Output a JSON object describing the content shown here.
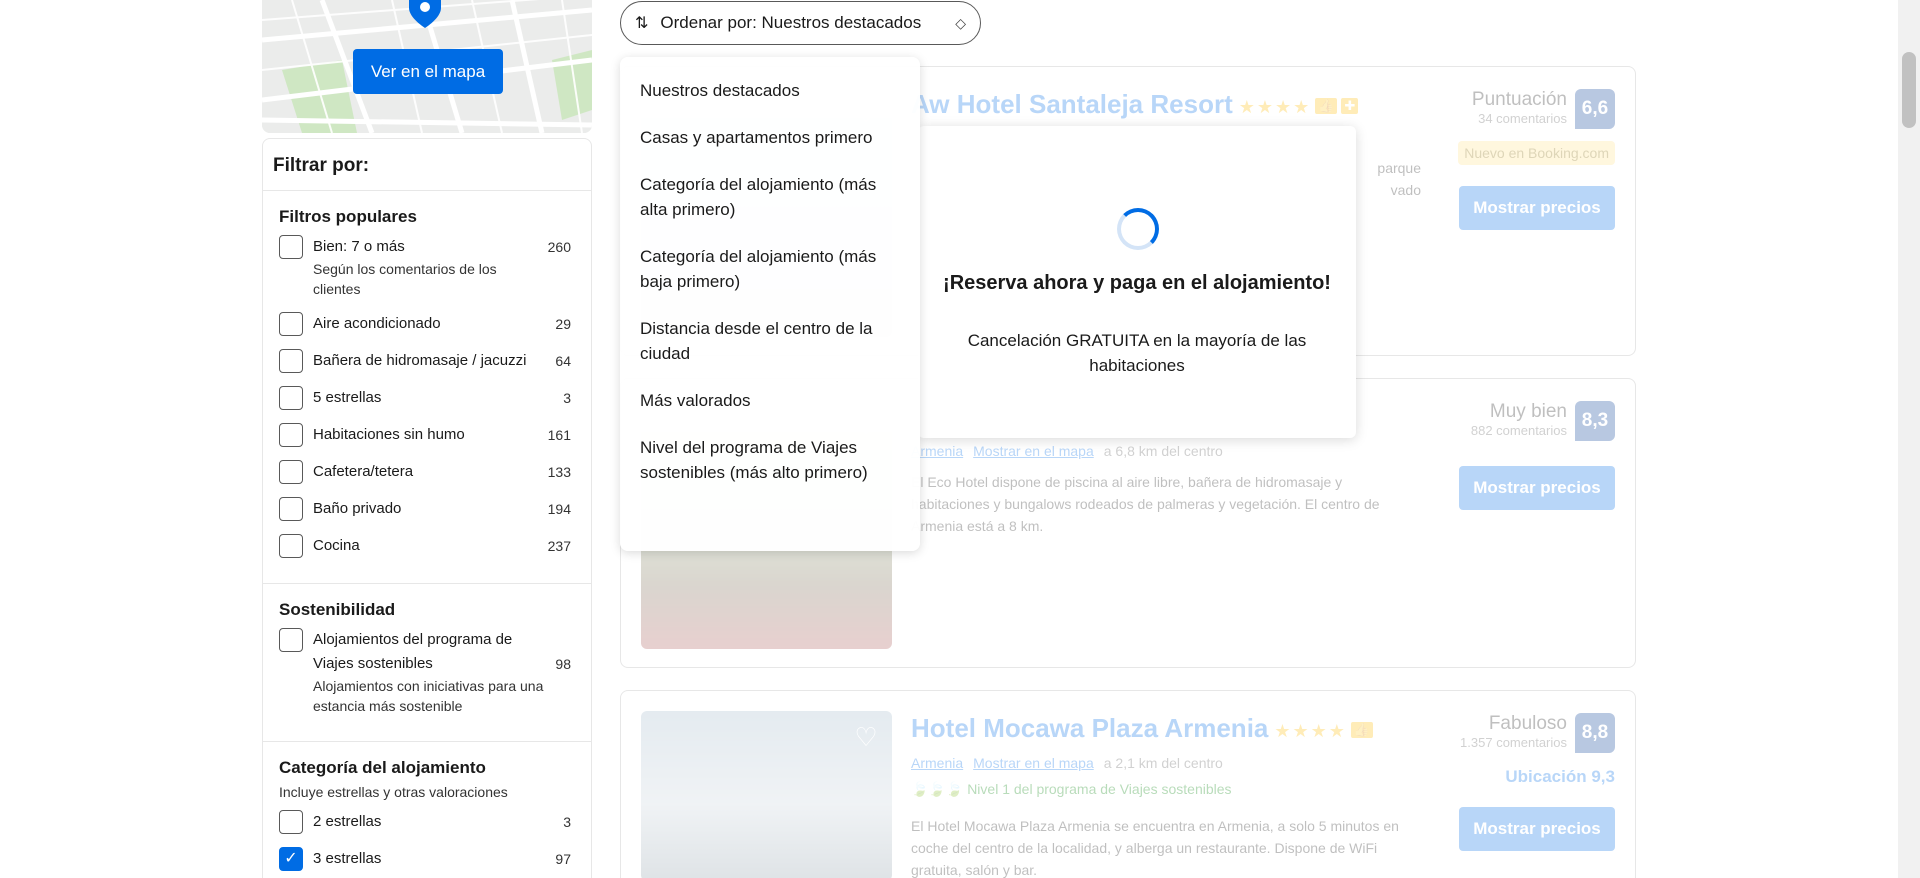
{
  "map": {
    "button_label": "Ver en el mapa"
  },
  "filters": {
    "title": "Filtrar por:",
    "popular": {
      "title": "Filtros populares",
      "items": [
        {
          "label": "Bien: 7 o más",
          "count": "260",
          "note": "Según los comentarios de los clientes"
        },
        {
          "label": "Aire acondicionado",
          "count": "29"
        },
        {
          "label": "Bañera de hidromasaje / jacuzzi",
          "count": "64"
        },
        {
          "label": "5 estrellas",
          "count": "3"
        },
        {
          "label": "Habitaciones sin humo",
          "count": "161"
        },
        {
          "label": "Cafetera/tetera",
          "count": "133"
        },
        {
          "label": "Baño privado",
          "count": "194"
        },
        {
          "label": "Cocina",
          "count": "237"
        }
      ]
    },
    "sustainability": {
      "title": "Sostenibilidad",
      "items": [
        {
          "label": "Alojamientos del programa de Viajes sostenibles",
          "count": "98",
          "note": "Alojamientos con iniciativas para una estancia más sostenible"
        }
      ]
    },
    "category": {
      "title": "Categoría del alojamiento",
      "subtitle": "Incluye estrellas y otras valoraciones",
      "items": [
        {
          "label": "2 estrellas",
          "count": "3",
          "checked": false
        },
        {
          "label": "3 estrellas",
          "count": "97",
          "checked": true
        }
      ]
    }
  },
  "sort": {
    "button_label": "Ordenar por: Nuestros destacados",
    "options": [
      "Nuestros destacados",
      "Casas y apartamentos primero",
      "Categoría del alojamiento (más alta primero)",
      "Categoría del alojamiento (más baja primero)",
      "Distancia desde el centro de la ciudad",
      "Más valorados",
      "Nivel del programa de Viajes sostenibles (más alto primero)"
    ]
  },
  "popup": {
    "title": "¡Reserva ahora y paga en el alojamiento!",
    "text": "Cancelación GRATUITA en la mayoría de las habitaciones"
  },
  "results": [
    {
      "name": "Aw Hotel Santaleja Resort",
      "stars": "★★★★",
      "score_label": "Puntuación",
      "reviews": "34 comentarios",
      "score": "6,6",
      "new_badge": "Nuevo en Booking.com",
      "desc_fragment": "parque\nvado",
      "button": "Mostrar precios"
    },
    {
      "city": "Armenia",
      "map_link": "Mostrar en el mapa",
      "distance": "a 6,8 km del centro",
      "score_label": "Muy bien",
      "reviews": "882 comentarios",
      "score": "8,3",
      "description": "El Eco Hotel dispone de piscina al aire libre, bañera de hidromasaje y habitaciones y bungalows rodeados de palmeras y vegetación. El centro de Armenia está a 8 km.",
      "button": "Mostrar precios"
    },
    {
      "name": "Hotel Mocawa Plaza Armenia",
      "stars": "★★★★",
      "city": "Armenia",
      "map_link": "Mostrar en el mapa",
      "distance": "a 2,1 km del centro",
      "sustainable": "Nivel 1 del programa de Viajes sostenibles",
      "score_label": "Fabuloso",
      "reviews": "1.357 comentarios",
      "score": "8,8",
      "location_score": "Ubicación 9,3",
      "description": "El Hotel Mocawa Plaza Armenia se encuentra en Armenia, a solo 5 minutos en coche del centro de la localidad, y alberga un restaurante. Dispone de WiFi gratuita, salón y bar.",
      "button": "Mostrar precios"
    }
  ]
}
